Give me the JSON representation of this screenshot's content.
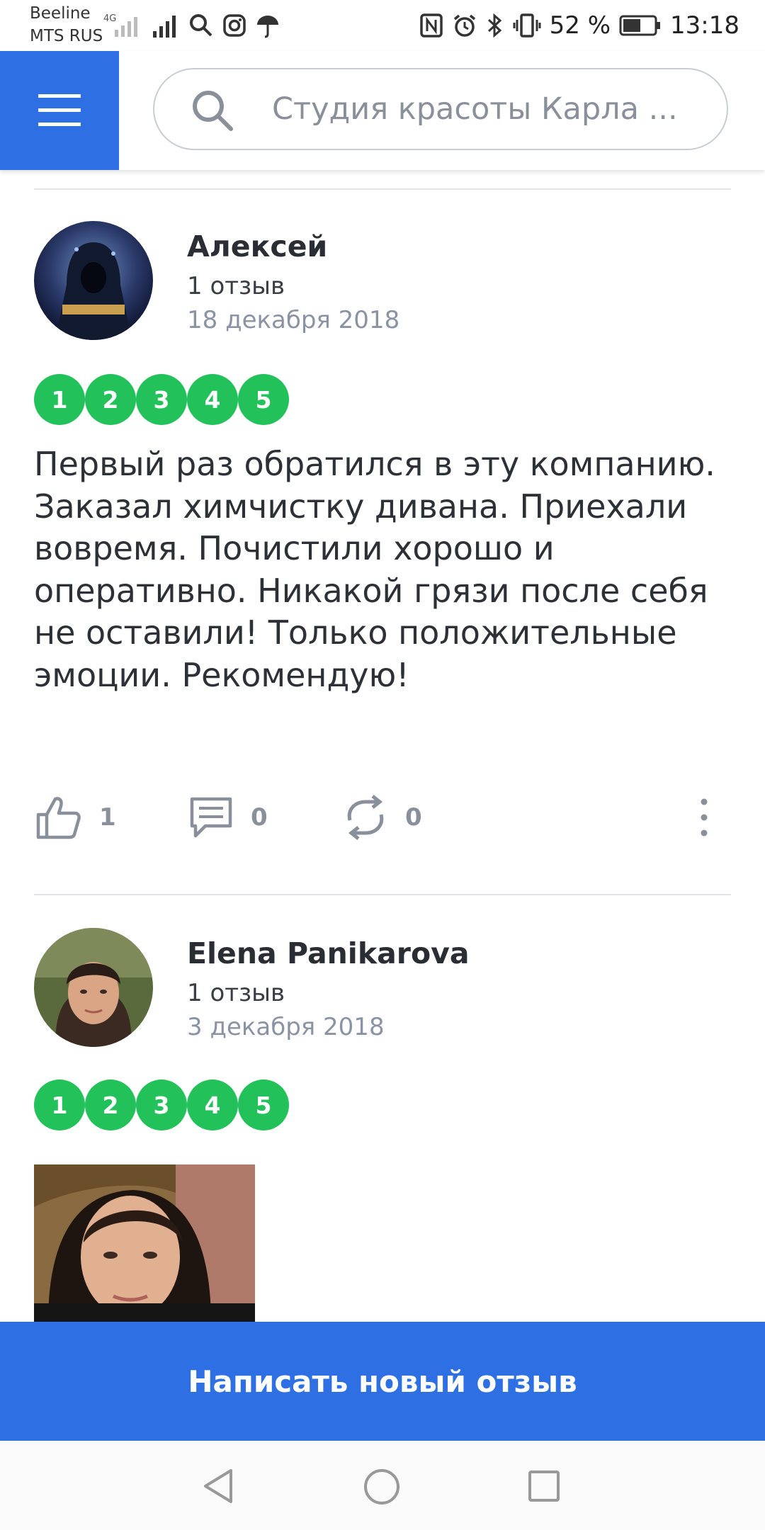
{
  "status_bar": {
    "carrier_1": "Beeline",
    "carrier_2": "MTS RUS",
    "battery_percent": "52 %",
    "time": "13:18"
  },
  "header": {
    "search_text": "Студия красоты Карла ..."
  },
  "reviews": [
    {
      "author": "Алексей",
      "reviews_count": "1 отзыв",
      "date": "18 декабря 2018",
      "rating_labels": [
        "1",
        "2",
        "3",
        "4",
        "5"
      ],
      "text": "Первый раз обратился в эту компанию. Заказал химчистку дивана. Приехали вовремя. Почистили хорошо и оперативно. Никакой грязи после себя не оставили! Только положительные эмоции. Рекомендую!",
      "likes": "1",
      "comments": "0",
      "reposts": "0"
    },
    {
      "author": "Elena Panikarova",
      "reviews_count": "1 отзыв",
      "date": "3 декабря 2018",
      "rating_labels": [
        "1",
        "2",
        "3",
        "4",
        "5"
      ]
    }
  ],
  "footer": {
    "write_review_label": "Написать новый отзыв"
  }
}
